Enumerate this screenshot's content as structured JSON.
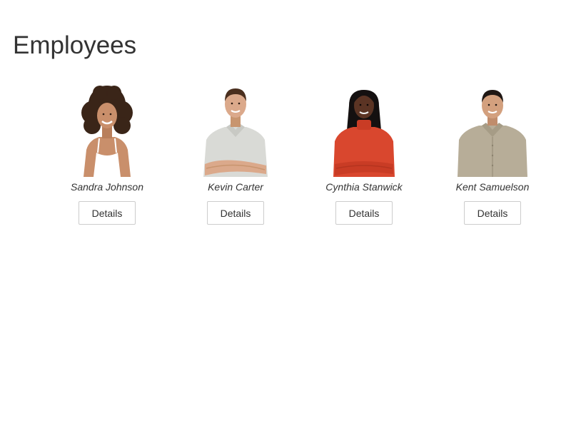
{
  "page": {
    "title": "Employees"
  },
  "employees": [
    {
      "name": "Sandra Johnson",
      "details_label": "Details",
      "photo": {
        "skin": "#c98f6b",
        "hair": "#3a2518",
        "shirt": "#ffffff"
      }
    },
    {
      "name": "Kevin Carter",
      "details_label": "Details",
      "photo": {
        "skin": "#dba98b",
        "hair": "#4a2f1e",
        "shirt": "#d9dad6"
      }
    },
    {
      "name": "Cynthia Stanwick",
      "details_label": "Details",
      "photo": {
        "skin": "#5b3424",
        "hair": "#141010",
        "shirt": "#d9472e"
      }
    },
    {
      "name": "Kent Samuelson",
      "details_label": "Details",
      "photo": {
        "skin": "#d3a07e",
        "hair": "#1f1714",
        "shirt": "#b7ad98"
      }
    }
  ]
}
